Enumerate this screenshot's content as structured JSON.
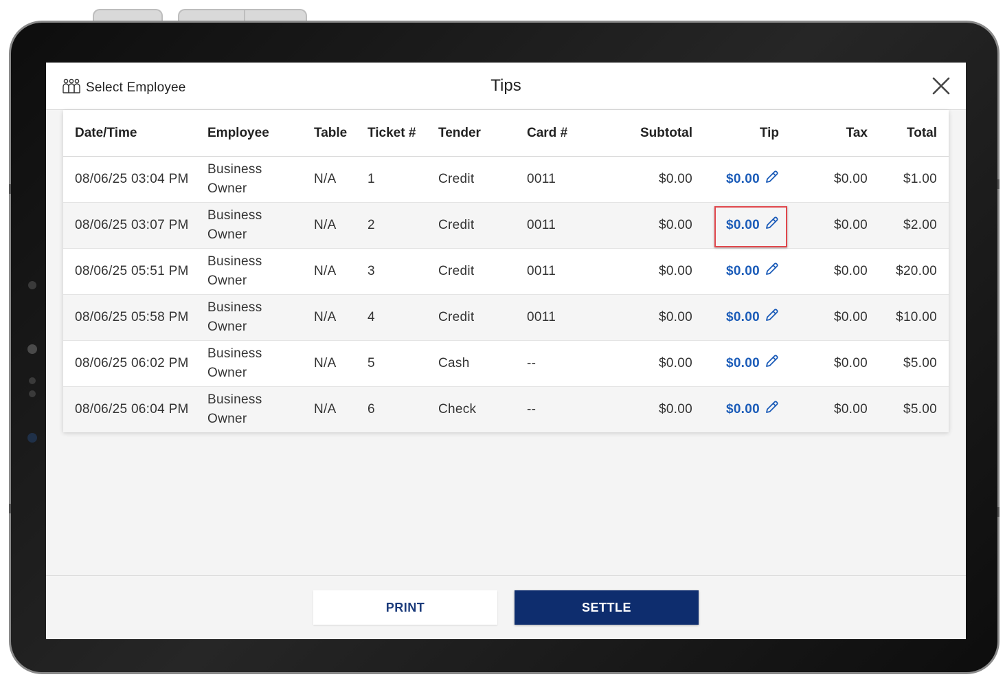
{
  "header": {
    "select_employee_label": "Select Employee",
    "title": "Tips"
  },
  "table": {
    "columns": [
      "Date/Time",
      "Employee",
      "Table",
      "Ticket #",
      "Tender",
      "Card #",
      "Subtotal",
      "Tip",
      "Tax",
      "Total"
    ],
    "rows": [
      {
        "datetime": "08/06/25 03:04 PM",
        "employee_first": "Business",
        "employee_last": "Owner",
        "table": "N/A",
        "ticket": "1",
        "tender": "Credit",
        "card": "0011",
        "subtotal": "$0.00",
        "tip": "$0.00",
        "tax": "$0.00",
        "total": "$1.00"
      },
      {
        "datetime": "08/06/25 03:07 PM",
        "employee_first": "Business",
        "employee_last": "Owner",
        "table": "N/A",
        "ticket": "2",
        "tender": "Credit",
        "card": "0011",
        "subtotal": "$0.00",
        "tip": "$0.00",
        "tax": "$0.00",
        "total": "$2.00"
      },
      {
        "datetime": "08/06/25 05:51 PM",
        "employee_first": "Business",
        "employee_last": "Owner",
        "table": "N/A",
        "ticket": "3",
        "tender": "Credit",
        "card": "0011",
        "subtotal": "$0.00",
        "tip": "$0.00",
        "tax": "$0.00",
        "total": "$20.00"
      },
      {
        "datetime": "08/06/25 05:58 PM",
        "employee_first": "Business",
        "employee_last": "Owner",
        "table": "N/A",
        "ticket": "4",
        "tender": "Credit",
        "card": "0011",
        "subtotal": "$0.00",
        "tip": "$0.00",
        "tax": "$0.00",
        "total": "$10.00"
      },
      {
        "datetime": "08/06/25 06:02 PM",
        "employee_first": "Business",
        "employee_last": "Owner",
        "table": "N/A",
        "ticket": "5",
        "tender": "Cash",
        "card": "--",
        "subtotal": "$0.00",
        "tip": "$0.00",
        "tax": "$0.00",
        "total": "$5.00"
      },
      {
        "datetime": "08/06/25 06:04 PM",
        "employee_first": "Business",
        "employee_last": "Owner",
        "table": "N/A",
        "ticket": "6",
        "tender": "Check",
        "card": "--",
        "subtotal": "$0.00",
        "tip": "$0.00",
        "tax": "$0.00",
        "total": "$5.00"
      }
    ]
  },
  "footer": {
    "print_label": "PRINT",
    "settle_label": "SETTLE"
  },
  "icons": {
    "employee": "people-group-icon",
    "close": "close-icon",
    "edit": "pencil-icon"
  },
  "colors": {
    "tip_link": "#1a5bb8",
    "settle_bg": "#0e2d6e",
    "highlight": "#e0474c"
  }
}
